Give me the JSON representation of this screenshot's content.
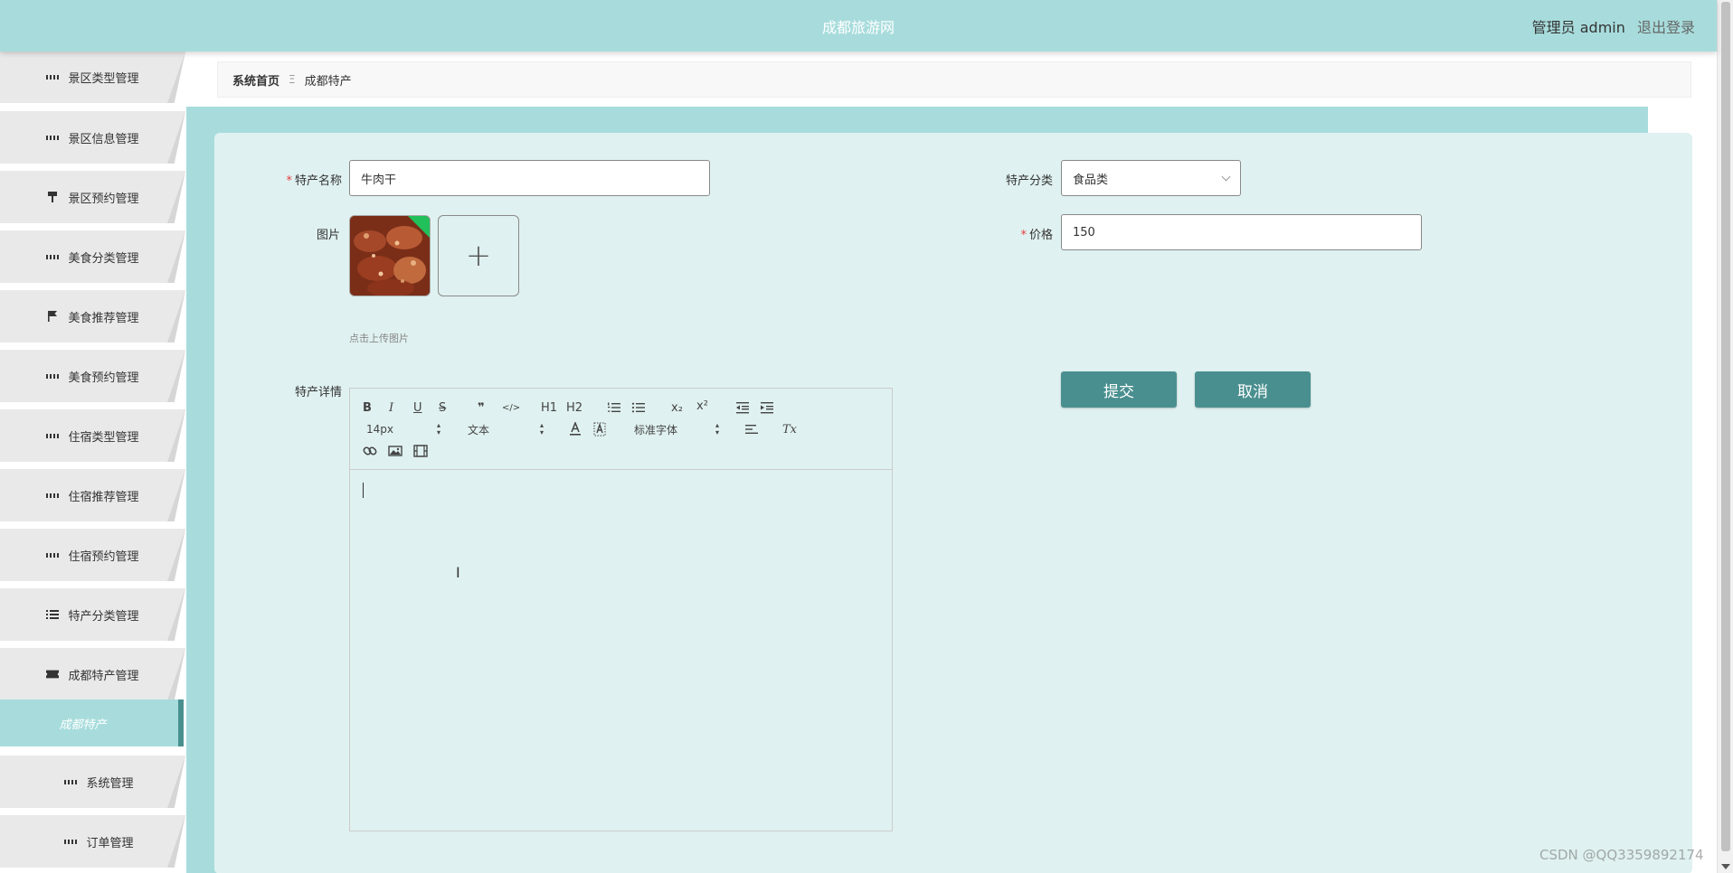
{
  "header": {
    "site_title": "成都旅游网",
    "user_label": "管理员 admin",
    "logout_label": "退出登录"
  },
  "sidebar": {
    "items": [
      {
        "label": "景区类型管理",
        "icon": "grid-icon"
      },
      {
        "label": "景区信息管理",
        "icon": "grid-icon"
      },
      {
        "label": "景区预约管理",
        "icon": "pin-icon"
      },
      {
        "label": "美食分类管理",
        "icon": "grid-icon"
      },
      {
        "label": "美食推荐管理",
        "icon": "flag-icon"
      },
      {
        "label": "美食预约管理",
        "icon": "grid-icon"
      },
      {
        "label": "住宿类型管理",
        "icon": "grid-icon"
      },
      {
        "label": "住宿推荐管理",
        "icon": "grid-icon"
      },
      {
        "label": "住宿预约管理",
        "icon": "grid-icon"
      },
      {
        "label": "特产分类管理",
        "icon": "list-icon"
      },
      {
        "label": "成都特产管理",
        "icon": "ticket-icon"
      },
      {
        "label": "成都特产",
        "icon": "",
        "active": true
      },
      {
        "label": "系统管理",
        "icon": "grid-icon"
      },
      {
        "label": "订单管理",
        "icon": "grid-icon"
      }
    ]
  },
  "breadcrumb": {
    "home": "系统首页",
    "separator": "Ξ",
    "current": "成都特产"
  },
  "form": {
    "name_label": "特产名称",
    "name_value": "牛肉干",
    "category_label": "特产分类",
    "category_value": "食品类",
    "image_label": "图片",
    "upload_hint": "点击上传图片",
    "price_label": "价格",
    "price_value": "150",
    "detail_label": "特产详情",
    "submit_label": "提交",
    "cancel_label": "取消",
    "required_mark": "*"
  },
  "editor": {
    "font_size": "14px",
    "text_style": "文本",
    "font_family": "标准字体",
    "buttons": {
      "bold": "B",
      "italic": "I",
      "underline": "U",
      "strike": "S",
      "quote": "❞",
      "code": "</>",
      "h1": "H1",
      "h2": "H2",
      "subscript": "x₂",
      "superscript": "x²",
      "clear": "Tx"
    }
  },
  "watermark": "CSDN @QQ3359892174"
}
